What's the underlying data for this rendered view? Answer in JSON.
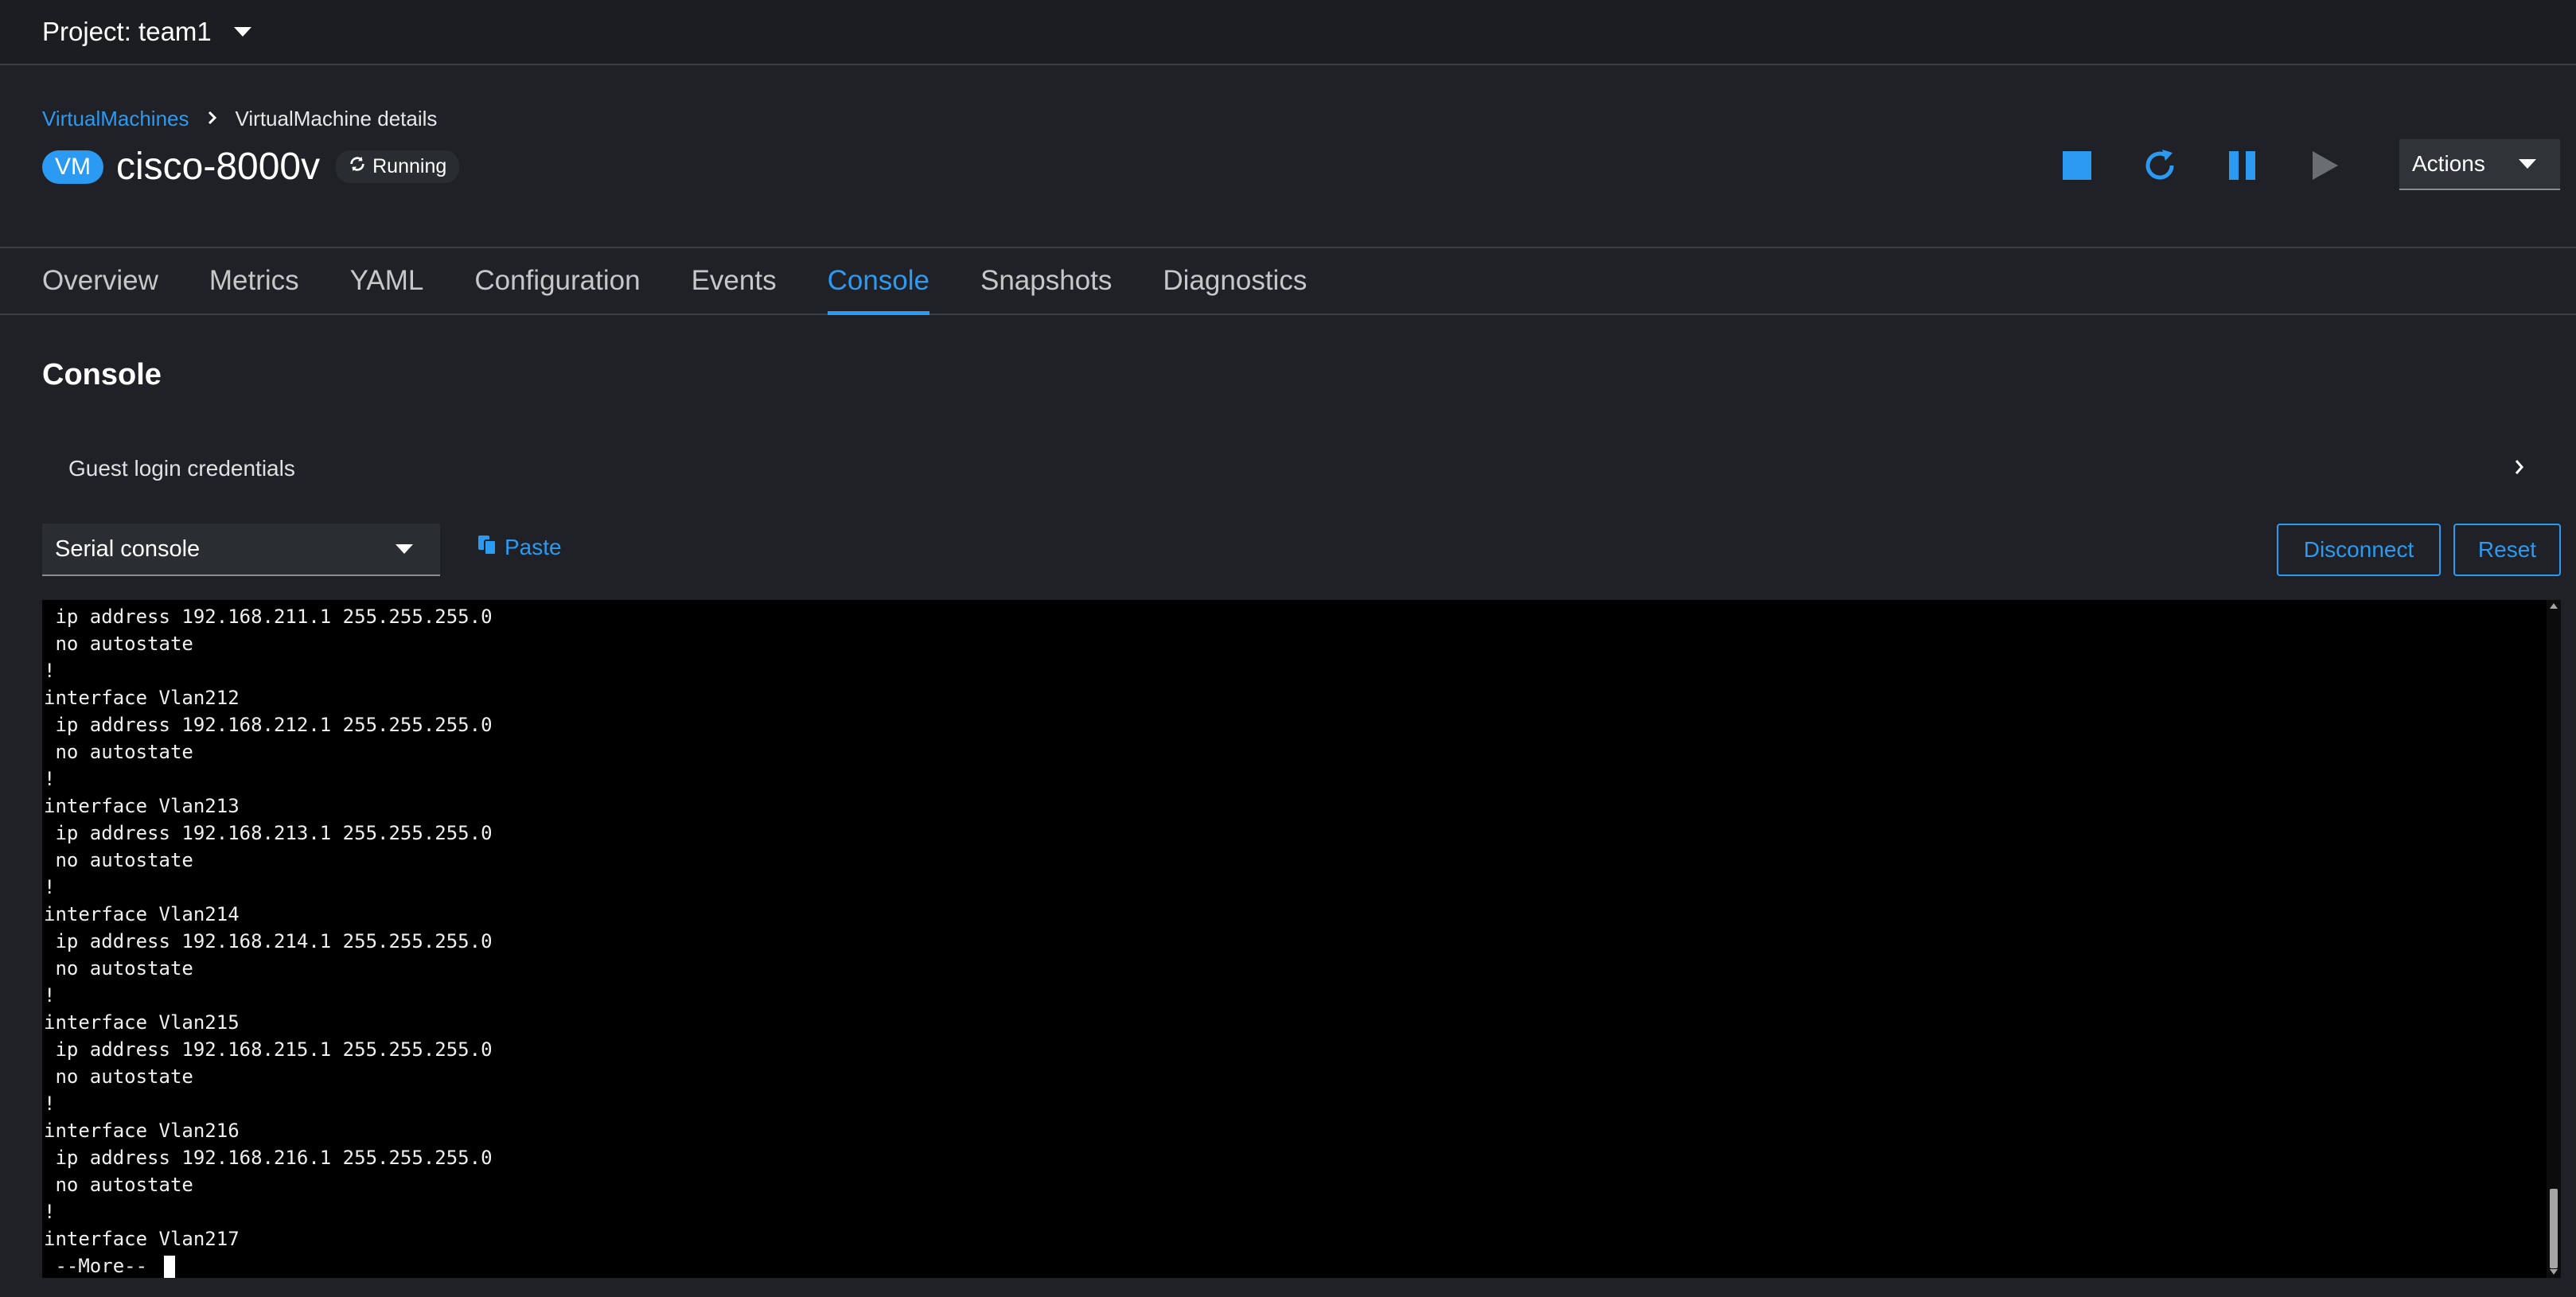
{
  "project": {
    "label": "Project: team1"
  },
  "breadcrumb": {
    "parent": "VirtualMachines",
    "current": "VirtualMachine details"
  },
  "vm": {
    "badge": "VM",
    "name": "cisco-8000v",
    "status": "Running"
  },
  "actions": {
    "label": "Actions"
  },
  "tabs": [
    "Overview",
    "Metrics",
    "YAML",
    "Configuration",
    "Events",
    "Console",
    "Snapshots",
    "Diagnostics"
  ],
  "active_tab": "Console",
  "console": {
    "title": "Console",
    "credentials_label": "Guest login credentials",
    "type_select": "Serial console",
    "paste_label": "Paste",
    "disconnect_label": "Disconnect",
    "reset_label": "Reset",
    "lines": [
      " ip address 192.168.211.1 255.255.255.0",
      " no autostate",
      "!",
      "interface Vlan212",
      " ip address 192.168.212.1 255.255.255.0",
      " no autostate",
      "!",
      "interface Vlan213",
      " ip address 192.168.213.1 255.255.255.0",
      " no autostate",
      "!",
      "interface Vlan214",
      " ip address 192.168.214.1 255.255.255.0",
      " no autostate",
      "!",
      "interface Vlan215",
      " ip address 192.168.215.1 255.255.255.0",
      " no autostate",
      "!",
      "interface Vlan216",
      " ip address 192.168.216.1 255.255.255.0",
      " no autostate",
      "!",
      "interface Vlan217"
    ],
    "prompt": " --More-- "
  },
  "colors": {
    "accent": "#2b9af3",
    "background": "#1f2126",
    "terminal_bg": "#000000"
  },
  "icons": [
    "caret-down-icon",
    "chevron-right-icon",
    "sync-icon",
    "stop-icon",
    "restart-icon",
    "pause-icon",
    "play-icon",
    "paste-icon"
  ]
}
